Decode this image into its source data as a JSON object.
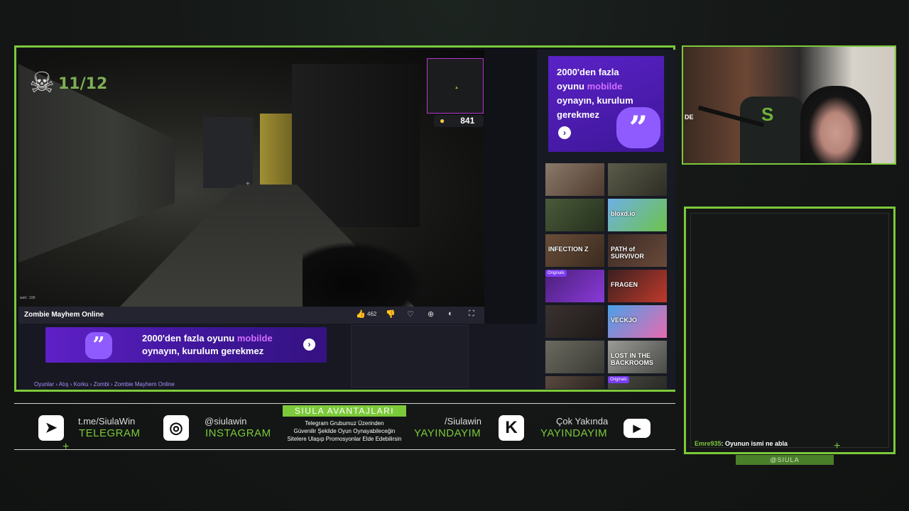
{
  "colors": {
    "accent_green": "#7cc93a",
    "promo_purple": "#5f20c7",
    "promo_accent": "#d36dff",
    "background": "#151817"
  },
  "game": {
    "kill_count": "11/12",
    "coins": "841",
    "title": "Zombie Mayhem Online",
    "likes": "462",
    "corner_text": "weit : 100",
    "icons": [
      "thumbs-up-icon",
      "thumbs-down-icon",
      "heart-icon",
      "crosshair-icon",
      "volume-icon",
      "fullscreen-icon"
    ]
  },
  "promo_wide": {
    "line1_prefix": "2000'den fazla oyunu ",
    "line1_accent": "mobilde",
    "line2": "oynayın, kurulum gerekmez"
  },
  "promo_tall": {
    "line1": "2000'den fazla",
    "line2_prefix": "oyunu ",
    "line2_accent": "mobilde",
    "line3": "oynayın, kurulum",
    "line4": "gerekmez"
  },
  "breadcrumb": [
    "Oyunlar",
    "Atış",
    "Korku",
    "Zombi",
    "Zombie Mayhem Online"
  ],
  "breadcrumb_sep": " › ",
  "thumbnails": [
    {
      "label": "",
      "badge": ""
    },
    {
      "label": "",
      "badge": ""
    },
    {
      "label": "",
      "badge": ""
    },
    {
      "label": "bloxd.io",
      "badge": ""
    },
    {
      "label": "INFECTION Z",
      "badge": ""
    },
    {
      "label": "PATH of SURVIVOR",
      "badge": ""
    },
    {
      "label": "",
      "badge": "Originals"
    },
    {
      "label": "FRAGEN",
      "badge": ""
    },
    {
      "label": "",
      "badge": ""
    },
    {
      "label": "VECKJO",
      "badge": ""
    },
    {
      "label": "",
      "badge": ""
    },
    {
      "label": "LOST IN THE BACKROOMS",
      "badge": ""
    },
    {
      "label": "",
      "badge": ""
    },
    {
      "label": "",
      "badge": "Originals"
    }
  ],
  "webcam": {
    "mark": "DE"
  },
  "chat": {
    "user": "Emre935",
    "message": ": Oyunun ismi ne abla",
    "handle": "@SIULA"
  },
  "social": {
    "telegram": {
      "handle": "t.me/SiulaWin",
      "label": "TELEGRAM"
    },
    "instagram": {
      "handle": "@siulawin",
      "label": "INSTAGRAM"
    },
    "advantages": {
      "title": "SIULA AVANTAJLARI",
      "line1": "Telegram Grubumuz Üzerinden",
      "line2": "Güvenilir Şekilde Oyun Oynayabileceğin",
      "line3": "Sitelere Ulaşıp Promosyonlar Elde Edebilirsin"
    },
    "kick": {
      "handle": "/Siulawin",
      "label": "YAYINDAYIM"
    },
    "youtube": {
      "handle": "Çok Yakında",
      "label": "YAYINDAYIM"
    }
  }
}
